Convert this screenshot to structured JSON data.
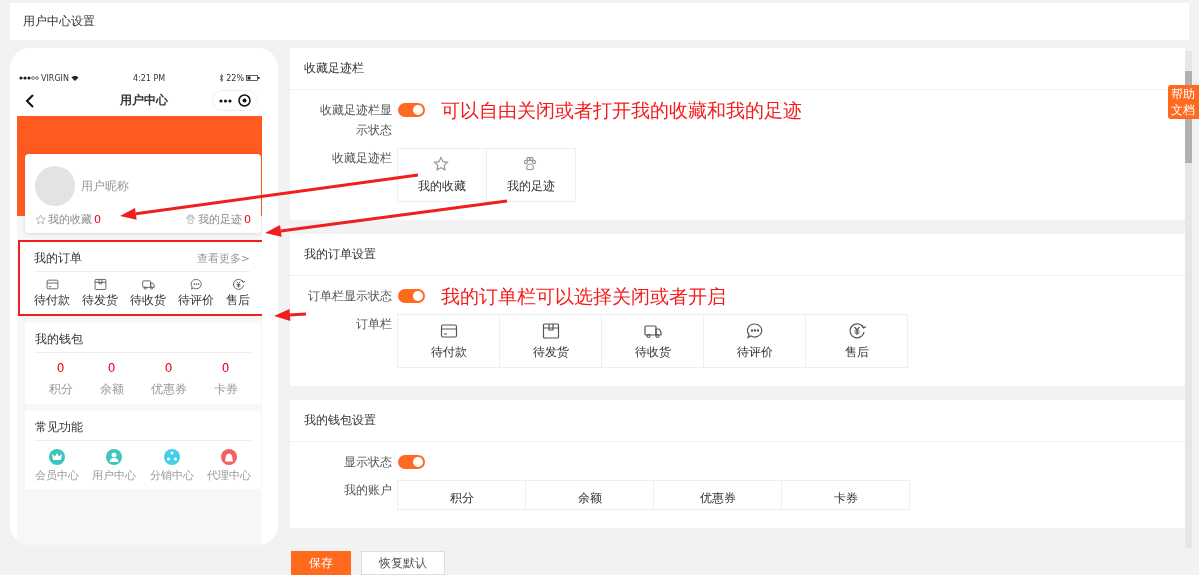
{
  "header": {
    "title": "用户中心设置"
  },
  "phone": {
    "status_bar": {
      "carrier": "VIRGIN",
      "time": "4:21 PM",
      "battery": "22%"
    },
    "nav": {
      "title": "用户中心"
    },
    "profile": {
      "nickname": "用户昵称",
      "stats": [
        {
          "label": "我的收藏",
          "value": "0"
        },
        {
          "label": "我的足迹",
          "value": "0"
        }
      ]
    },
    "orders": {
      "title": "我的订单",
      "more": "查看更多>",
      "highlighted": true,
      "items": [
        {
          "label": "待付款"
        },
        {
          "label": "待发货"
        },
        {
          "label": "待收货"
        },
        {
          "label": "待评价"
        },
        {
          "label": "售后"
        }
      ]
    },
    "wallet": {
      "title": "我的钱包",
      "items": [
        {
          "value": "0",
          "label": "积分"
        },
        {
          "value": "0",
          "label": "余额"
        },
        {
          "value": "0",
          "label": "优惠券"
        },
        {
          "value": "0",
          "label": "卡券"
        }
      ]
    },
    "functions": {
      "title": "常见功能",
      "items": [
        {
          "label": "会员中心",
          "color": "#3cc4bf"
        },
        {
          "label": "用户中心",
          "color": "#3cc4bf"
        },
        {
          "label": "分销中心",
          "color": "#45cfe6"
        },
        {
          "label": "代理中心",
          "color": "#f26161"
        }
      ]
    }
  },
  "sections": [
    {
      "title": "收藏足迹栏",
      "toggle": {
        "label": "收藏足迹栏显示状态",
        "on": true
      },
      "note": "可以自由关闭或者打开我的收藏和我的足迹",
      "grid": {
        "label": "收藏足迹栏",
        "kind": "stats",
        "items": [
          {
            "label": "我的收藏"
          },
          {
            "label": "我的足迹"
          }
        ]
      }
    },
    {
      "title": "我的订单设置",
      "toggle": {
        "label": "订单栏显示状态",
        "on": true
      },
      "note": "我的订单栏可以选择关闭或者开启",
      "grid": {
        "label": "订单栏",
        "kind": "orders",
        "items": [
          {
            "label": "待付款"
          },
          {
            "label": "待发货"
          },
          {
            "label": "待收货"
          },
          {
            "label": "待评价"
          },
          {
            "label": "售后"
          }
        ]
      }
    },
    {
      "title": "我的钱包设置",
      "toggle": {
        "label": "显示状态",
        "on": true
      },
      "grid": {
        "label": "我的账户",
        "kind": "wallet",
        "items": [
          {
            "label": "积分"
          },
          {
            "label": "余额"
          },
          {
            "label": "优惠券"
          },
          {
            "label": "卡券"
          }
        ]
      }
    }
  ],
  "help_tab": "帮助文档",
  "buttons": [
    {
      "label": "保存",
      "kind": "primary"
    },
    {
      "label": "恢复默认",
      "kind": "default"
    }
  ]
}
